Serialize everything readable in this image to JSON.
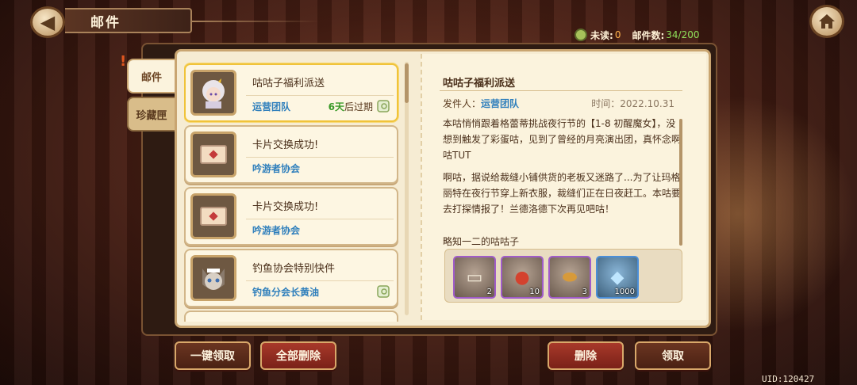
{
  "header": {
    "title": "邮件"
  },
  "stats": {
    "unread_label": "未读:",
    "unread_value": "0",
    "count_label": "邮件数:",
    "count_value": "34/200"
  },
  "tabs": [
    {
      "label": "邮件"
    },
    {
      "label": "珍藏匣"
    }
  ],
  "mails": [
    {
      "subject": "咕咕子福利派送",
      "sender": "运营团队",
      "expire_days": "6天",
      "expire_suffix": "后过期",
      "avatar": "girl-character",
      "selected": true
    },
    {
      "subject": "卡片交换成功!",
      "sender": "吟游者协会",
      "avatar": "envelope"
    },
    {
      "subject": "卡片交换成功!",
      "sender": "吟游者协会",
      "avatar": "envelope"
    },
    {
      "subject": "钓鱼协会特别快件",
      "sender": "钓鱼分会长黄油",
      "avatar": "cat-character"
    }
  ],
  "detail": {
    "title": "咕咕子福利派送",
    "sender_label": "发件人：",
    "sender": "运营团队",
    "time": "时间：2022.10.31",
    "paragraphs": [
      "本咕悄悄跟着格蕾蒂挑战夜行节的【1-8 初醒魔女】，没想到触发了彩蛋咕，见到了曾经的月亮演出团，真怀念啊咕TUT",
      "啊咕，据说给裁缝小铺供货的老板又迷路了...为了让玛格丽特在夜行节穿上新衣服，裁缝们正在日夜赶工。本咕要去打探情报了！兰德洛德下次再见吧咕！"
    ],
    "reward_label": "略知一二的咕咕子",
    "rewards": [
      {
        "icon": "ticket-icon",
        "qty": "2"
      },
      {
        "icon": "mushroom-icon",
        "qty": "10"
      },
      {
        "icon": "bread-icon",
        "qty": "3"
      },
      {
        "icon": "crystal-icon",
        "qty": "1000"
      }
    ]
  },
  "buttons": {
    "claim_all": "一键领取",
    "delete_all": "全部删除",
    "delete": "删除",
    "claim": "领取"
  },
  "uid": "UID:120427"
}
